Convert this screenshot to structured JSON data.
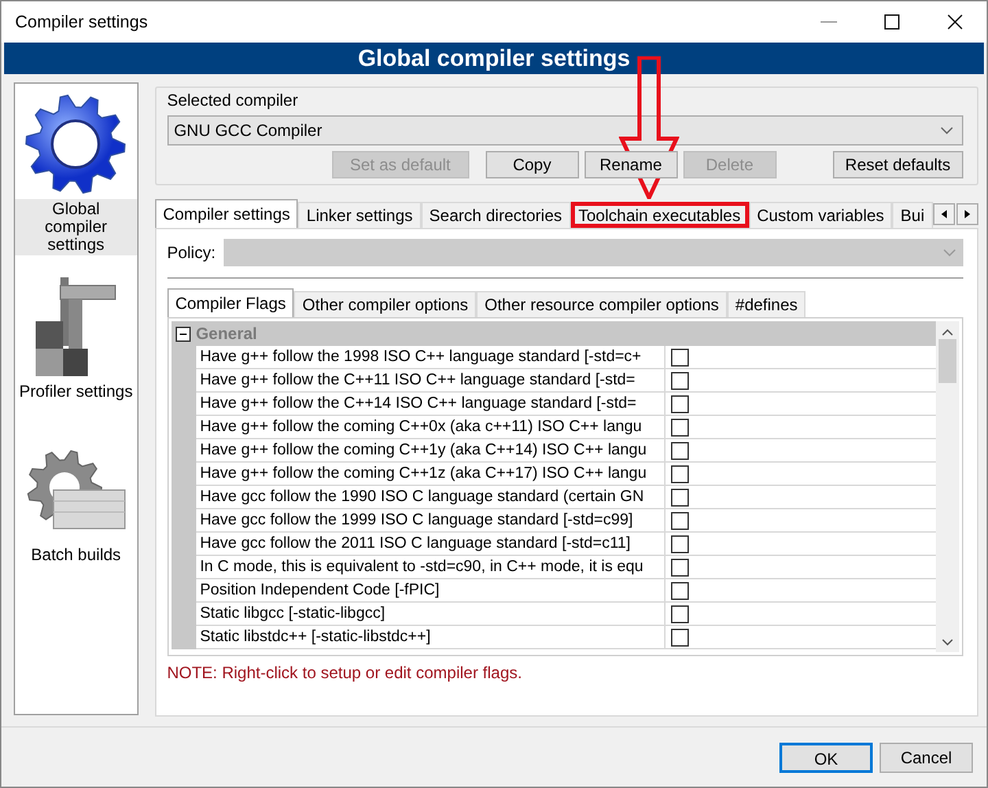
{
  "window": {
    "title": "Compiler settings"
  },
  "header": "Global compiler settings",
  "sidebar": {
    "items": [
      {
        "label": "Global compiler settings",
        "kind": "gear",
        "selected": true
      },
      {
        "label": "Profiler settings",
        "kind": "caliper",
        "selected": false
      },
      {
        "label": "Batch builds",
        "kind": "batch",
        "selected": false
      }
    ]
  },
  "selected_compiler": {
    "label": "Selected compiler",
    "value": "GNU GCC Compiler",
    "buttons": [
      {
        "label": "Set as default",
        "disabled": true
      },
      {
        "label": "Copy",
        "disabled": false
      },
      {
        "label": "Rename",
        "disabled": false
      },
      {
        "label": "Delete",
        "disabled": true
      },
      {
        "label": "Reset defaults",
        "disabled": false
      }
    ]
  },
  "tabs": [
    {
      "label": "Compiler settings",
      "selected": true,
      "highlighted": false
    },
    {
      "label": "Linker settings",
      "selected": false,
      "highlighted": false
    },
    {
      "label": "Search directories",
      "selected": false,
      "highlighted": false
    },
    {
      "label": "Toolchain executables",
      "selected": false,
      "highlighted": true
    },
    {
      "label": "Custom variables",
      "selected": false,
      "highlighted": false
    },
    {
      "label": "Bui",
      "selected": false,
      "highlighted": false
    }
  ],
  "policy": {
    "label": "Policy:",
    "disabled": true
  },
  "inner_tabs": [
    {
      "label": "Compiler Flags",
      "selected": true
    },
    {
      "label": "Other compiler options",
      "selected": false
    },
    {
      "label": "Other resource compiler options",
      "selected": false
    },
    {
      "label": "#defines",
      "selected": false
    }
  ],
  "flags": {
    "group": {
      "label": "General",
      "expanded": true
    },
    "rows": [
      {
        "label": "Have g++ follow the 1998 ISO C++ language standard  [-std=c+",
        "checked": false
      },
      {
        "label": "Have g++ follow the C++11 ISO C++ language standard  [-std=",
        "checked": false
      },
      {
        "label": "Have g++ follow the C++14 ISO C++ language standard  [-std=",
        "checked": false
      },
      {
        "label": "Have g++ follow the coming C++0x (aka c++11) ISO C++ langu",
        "checked": false
      },
      {
        "label": "Have g++ follow the coming C++1y (aka C++14) ISO C++ langu",
        "checked": false
      },
      {
        "label": "Have g++ follow the coming C++1z (aka C++17) ISO C++ langu",
        "checked": false
      },
      {
        "label": "Have gcc follow the 1990 ISO C language standard  (certain GN",
        "checked": false
      },
      {
        "label": "Have gcc follow the 1999 ISO C language standard  [-std=c99]",
        "checked": false
      },
      {
        "label": "Have gcc follow the 2011 ISO C language standard  [-std=c11]",
        "checked": false
      },
      {
        "label": "In C mode, this is equivalent to -std=c90, in C++ mode, it is equ",
        "checked": false
      },
      {
        "label": "Position Independent Code  [-fPIC]",
        "checked": false
      },
      {
        "label": "Static libgcc  [-static-libgcc]",
        "checked": false
      },
      {
        "label": "Static libstdc++  [-static-libstdc++]",
        "checked": false
      }
    ]
  },
  "note": "NOTE: Right-click to setup or edit compiler flags.",
  "footer_buttons": [
    {
      "label": "OK",
      "default": true
    },
    {
      "label": "Cancel",
      "default": false
    }
  ]
}
